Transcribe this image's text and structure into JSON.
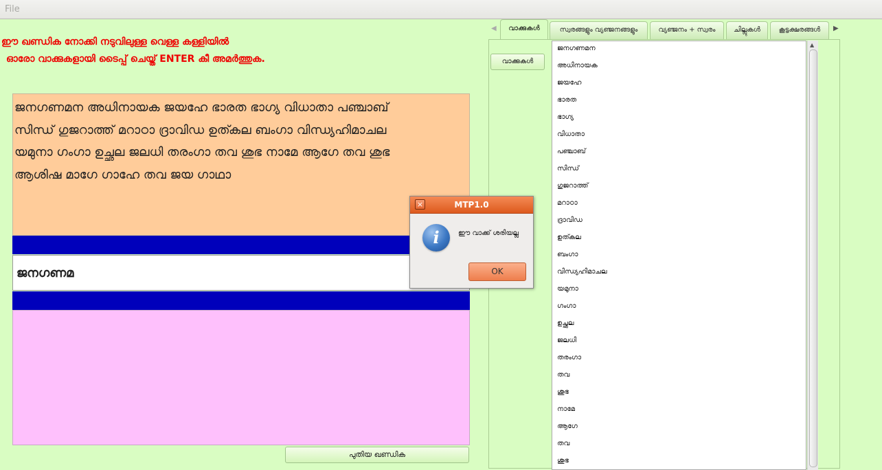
{
  "menubar": {
    "file_label": "File"
  },
  "instructions": {
    "line1": "ഈ ഖണ്ഡിക നോക്കി നടുവിലുള്ള വെള്ള കള്ളിയിൽ",
    "line2": "ഓരോ വാക്കുകളായി ടൈപ്പ് ചെയ്ത് ENTER കീ അമർത്തുക."
  },
  "passage": {
    "lines": [
      "ജനഗണമന അധിനായക ജയഹേ ഭാരത ഭാഗ്യ വിധാതാ പഞ്ചാബ്",
      "സിന്ധ് ഗുജറാത്ത് മറാഠാ ദ്രാവിഡ ഉത്കല ബംഗാ വിന്ധ്യഹിമാചല",
      "യമുനാ ഗംഗാ ഉച്ഛല ജലധി തരംഗാ തവ ശുഭ നാമേ ആഗേ തവ ശുഭ",
      "ആശിഷ മാഗേ ഗാഹേ തവ ജയ ഗാഥാ"
    ]
  },
  "input": {
    "value": "ജനഗണമ"
  },
  "new_paragraph_button": "പുതിയ ഖണ്ഡിക",
  "tabs": [
    {
      "label": "വാക്കുകൾ",
      "active": true
    },
    {
      "label": "സ്വരങ്ങളും വ്യഞ്ജനങ്ങളും",
      "active": false
    },
    {
      "label": "വ്യഞ്ജനം + സ്വരം",
      "active": false
    },
    {
      "label": "ചില്ലുകൾ",
      "active": false
    },
    {
      "label": "കൂട്ടക്ഷരങ്ങൾ",
      "active": false
    }
  ],
  "words_panel": {
    "button_label": "വാക്കുകൾ",
    "items": [
      "ജനഗണമന",
      "അധിനായക",
      "ജയഹേ",
      "ഭാരത",
      "ഭാഗ്യ",
      "വിധാതാ",
      "പഞ്ചാബ്",
      "സിന്ധ്",
      "ഗുജറാത്ത്",
      "മറാഠാ",
      "ദ്രാവിഡ",
      "ഉത്കല",
      "ബംഗാ",
      "വിന്ധ്യഹിമാചല",
      "യമുനാ",
      "ഗംഗാ",
      "ഉച്ഛല",
      "ജലധി",
      "തരംഗാ",
      "തവ",
      "ശുഭ",
      "നാമേ",
      "ആഗേ",
      "തവ",
      "ശുഭ"
    ]
  },
  "dialog": {
    "title": "MTP1.0",
    "message": "ഈ വാക്ക് ശരിയല്ല",
    "ok_label": "OK",
    "icon": "info-icon"
  },
  "colors": {
    "background": "#d9fdc2",
    "instruction_text": "#ee0000",
    "passage_bg": "#ffcc9a",
    "bar_blue": "#0000bb",
    "feedback_bg": "#fec0fc",
    "dialog_titlebar": "#e4672c"
  }
}
